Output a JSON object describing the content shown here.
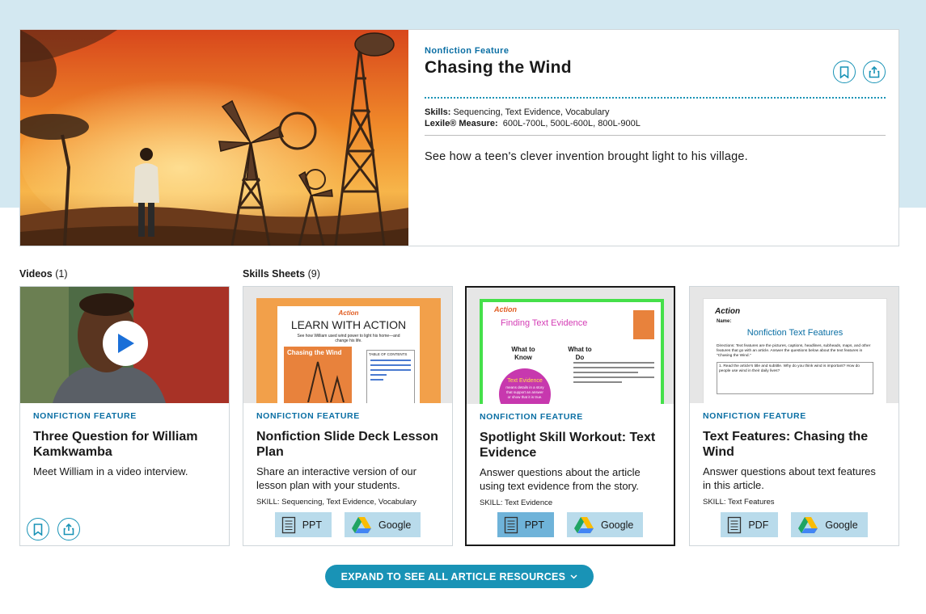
{
  "hero": {
    "kicker": "Nonfiction Feature",
    "title": "Chasing the Wind",
    "skills_label": "Skills:",
    "skills_value": "Sequencing, Text Evidence, Vocabulary",
    "lexile_label": "Lexile® Measure:",
    "lexile_value": "600L-700L, 500L-600L, 800L-900L",
    "description": "See how a teen's clever invention brought light to his village."
  },
  "sections": {
    "videos_label": "Videos",
    "videos_count": "(1)",
    "skills_label": "Skills Sheets",
    "skills_count": "(9)"
  },
  "cards": [
    {
      "kicker": "NONFICTION FEATURE",
      "title": "Three Question for William Kamkwamba",
      "desc": "Meet William in a video interview."
    },
    {
      "kicker": "NONFICTION FEATURE",
      "title": "Nonfiction Slide Deck Lesson Plan",
      "desc": "Share an interactive version of our lesson plan with your students.",
      "skill_label": "SKILL:",
      "skill_value": "Sequencing, Text Evidence, Vocabulary",
      "btn1": "PPT",
      "btn2": "Google",
      "thumb_heading": "LEARN WITH ACTION",
      "thumb_sub": "See how William used wind power to light his home—and change his life.",
      "thumb_toc": "TABLE OF CONTENTS",
      "thumb_logo": "Action",
      "thumb_mag": "Chasing the Wind"
    },
    {
      "kicker": "NONFICTION FEATURE",
      "title": "Spotlight Skill Workout: Text Evidence",
      "desc": "Answer questions about the article using text evidence from the story.",
      "skill_label": "SKILL:",
      "skill_value": "Text Evidence",
      "btn1": "PPT",
      "btn2": "Google",
      "thumb_logo": "Action",
      "thumb_heading": "Finding Text Evidence",
      "thumb_know": "What to Know",
      "thumb_do": "What to Do",
      "thumb_bubble": "Text Evidence",
      "thumb_bubble_sub": "means details in a story that support an answer or show that it is true."
    },
    {
      "kicker": "NONFICTION FEATURE",
      "title": "Text Features: Chasing the Wind",
      "desc": "Answer questions about text features in this article.",
      "skill_label": "SKILL:",
      "skill_value": "Text Features",
      "btn1": "PDF",
      "btn2": "Google",
      "thumb_logo": "Action",
      "thumb_name": "Name:",
      "thumb_heading": "Nonfiction Text Features",
      "thumb_directions": "Directions: Text features are the pictures, captions, headlines, subheads, maps, and other features that go with an article. Answer the questions below about the text features in \"Chasing the Wind.\"",
      "thumb_q1": "1. Read the article's title and subtitle. Why do you think wind is important? How do people use wind in their daily lives?"
    }
  ],
  "expand_label": "EXPAND TO SEE ALL ARTICLE RESOURCES"
}
